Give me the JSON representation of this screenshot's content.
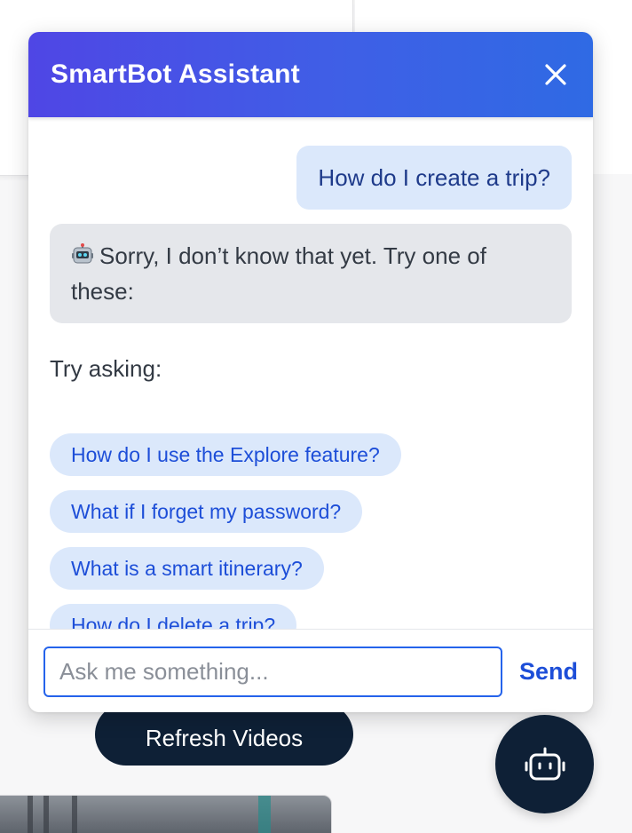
{
  "background": {
    "refresh_button_label": "Refresh Videos"
  },
  "chat": {
    "title": "SmartBot Assistant",
    "close_icon": "close-icon",
    "messages": [
      {
        "role": "user",
        "text": "How do I create a trip?"
      },
      {
        "role": "bot",
        "icon": "robot-emoji",
        "text": "Sorry, I don’t know that yet. Try one of these:"
      }
    ],
    "suggestions_label": "Try asking:",
    "suggestions": [
      "How do I use the Explore feature?",
      "What if I forget my password?",
      "What is a smart itinerary?",
      "How do I delete a trip?"
    ],
    "input": {
      "value": "",
      "placeholder": "Ask me something..."
    },
    "send_label": "Send",
    "launcher_icon": "robot-icon"
  },
  "colors": {
    "header_gradient_start": "#4f46e5",
    "header_gradient_end": "#2f6ae4",
    "user_bubble": "#dbe8fb",
    "bot_bubble": "#e5e7eb",
    "accent": "#1d4ed8",
    "launcher": "#0e2036"
  }
}
